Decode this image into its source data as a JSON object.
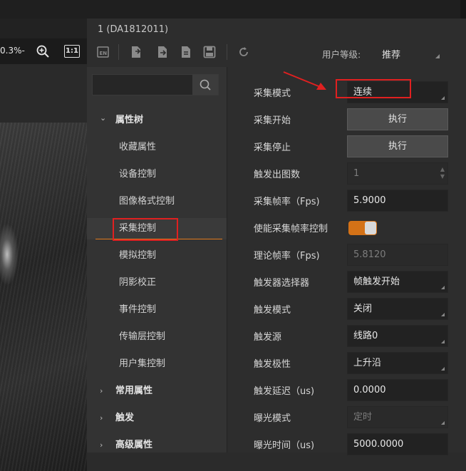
{
  "viewer": {
    "zoom_text": "0.3%-",
    "fit_label": "1:1"
  },
  "panel": {
    "title": "1 (DA1812011)",
    "toolbar": {
      "user_level_label": "用户等级:",
      "user_level_value": "推荐"
    }
  },
  "tree": {
    "search_placeholder": "",
    "items": [
      {
        "label": "属性树",
        "type": "group",
        "expanded": true
      },
      {
        "label": "收藏属性",
        "type": "child"
      },
      {
        "label": "设备控制",
        "type": "child"
      },
      {
        "label": "图像格式控制",
        "type": "child"
      },
      {
        "label": "采集控制",
        "type": "child",
        "active": true
      },
      {
        "label": "模拟控制",
        "type": "child"
      },
      {
        "label": "阴影校正",
        "type": "child"
      },
      {
        "label": "事件控制",
        "type": "child"
      },
      {
        "label": "传输层控制",
        "type": "child"
      },
      {
        "label": "用户集控制",
        "type": "child"
      },
      {
        "label": "常用属性",
        "type": "group",
        "expanded": false
      },
      {
        "label": "触发",
        "type": "group",
        "expanded": false
      },
      {
        "label": "高级属性",
        "type": "group",
        "expanded": false
      }
    ]
  },
  "props": [
    {
      "label": "采集模式",
      "value": "连续",
      "kind": "dropdown"
    },
    {
      "label": "采集开始",
      "value": "执行",
      "kind": "button"
    },
    {
      "label": "采集停止",
      "value": "执行",
      "kind": "button"
    },
    {
      "label": "触发出图数",
      "value": "1",
      "kind": "spin-disabled"
    },
    {
      "label": "采集帧率（Fps)",
      "value": "5.9000",
      "kind": "input"
    },
    {
      "label": "使能采集帧率控制",
      "value": "on",
      "kind": "toggle"
    },
    {
      "label": "理论帧率（Fps)",
      "value": "5.8120",
      "kind": "readonly"
    },
    {
      "label": "触发器选择器",
      "value": "帧触发开始",
      "kind": "dropdown"
    },
    {
      "label": "触发模式",
      "value": "关闭",
      "kind": "dropdown"
    },
    {
      "label": "触发源",
      "value": "线路0",
      "kind": "dropdown"
    },
    {
      "label": "触发极性",
      "value": "上升沿",
      "kind": "dropdown"
    },
    {
      "label": "触发延迟（us)",
      "value": "0.0000",
      "kind": "input"
    },
    {
      "label": "曝光模式",
      "value": "定时",
      "kind": "dropdown-disabled"
    },
    {
      "label": "曝光时间（us)",
      "value": "5000.0000",
      "kind": "input"
    }
  ],
  "colors": {
    "accent": "#d47217",
    "highlight_box": "#e02020"
  }
}
